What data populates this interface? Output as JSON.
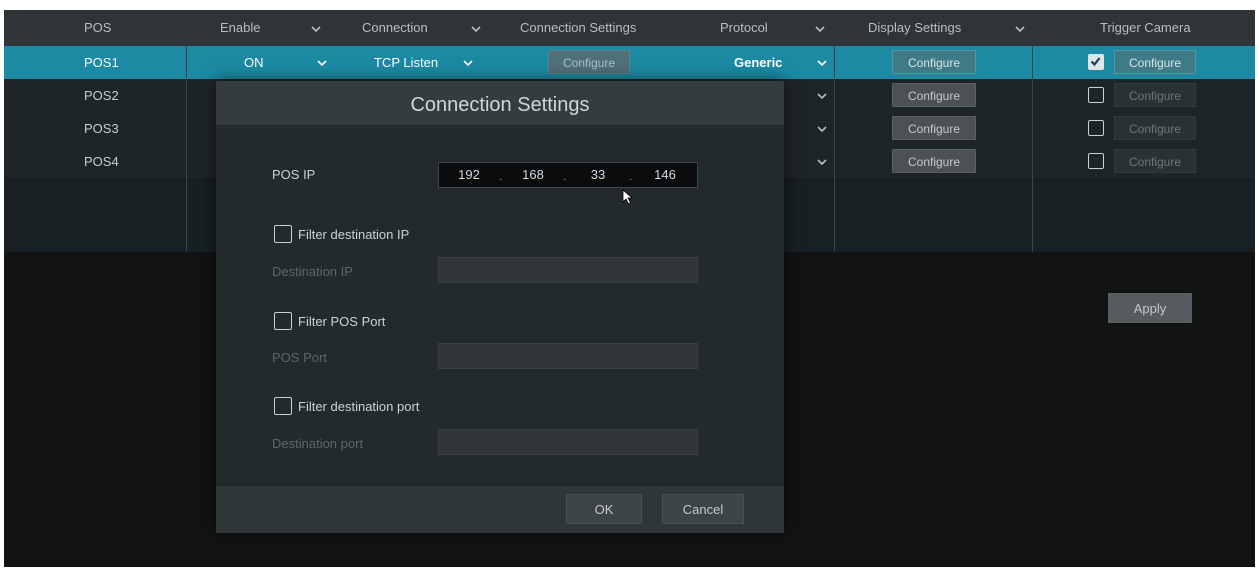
{
  "table": {
    "headers": {
      "pos": "POS",
      "enable": "Enable",
      "connection": "Connection",
      "connection_settings": "Connection Settings",
      "protocol": "Protocol",
      "display_settings": "Display Settings",
      "trigger_camera": "Trigger Camera"
    },
    "rows": [
      {
        "name": "POS1",
        "enable": "ON",
        "connection": "TCP Listen",
        "connection_settings": "Configure",
        "protocol": "Generic",
        "display_settings": "Configure",
        "trigger_checked": true,
        "trigger_configure": "Configure"
      },
      {
        "name": "POS2",
        "display_settings": "Configure",
        "trigger_checked": false,
        "trigger_configure": "Configure"
      },
      {
        "name": "POS3",
        "display_settings": "Configure",
        "trigger_checked": false,
        "trigger_configure": "Configure"
      },
      {
        "name": "POS4",
        "display_settings": "Configure",
        "trigger_checked": false,
        "trigger_configure": "Configure"
      }
    ]
  },
  "apply_label": "Apply",
  "dialog": {
    "title": "Connection Settings",
    "pos_ip_label": "POS IP",
    "pos_ip": [
      "192",
      "168",
      "33",
      "146"
    ],
    "filter_destination_ip": {
      "label": "Filter destination IP",
      "checked": false
    },
    "destination_ip_label": "Destination IP",
    "filter_pos_port": {
      "label": "Filter POS Port",
      "checked": false
    },
    "pos_port_label": "POS Port",
    "filter_destination_port": {
      "label": "Filter destination port",
      "checked": false
    },
    "destination_port_label": "Destination port",
    "ok_label": "OK",
    "cancel_label": "Cancel"
  },
  "colors": {
    "selected_row": "#1c8aa3",
    "header_bg": "#2f3537",
    "screen_bg": "#121414",
    "dialog_bg": "#232a2c"
  },
  "icons": {
    "dropdown": "chevron-down-icon",
    "checkbox": "checkbox-icon",
    "cursor": "mouse-pointer-icon"
  }
}
